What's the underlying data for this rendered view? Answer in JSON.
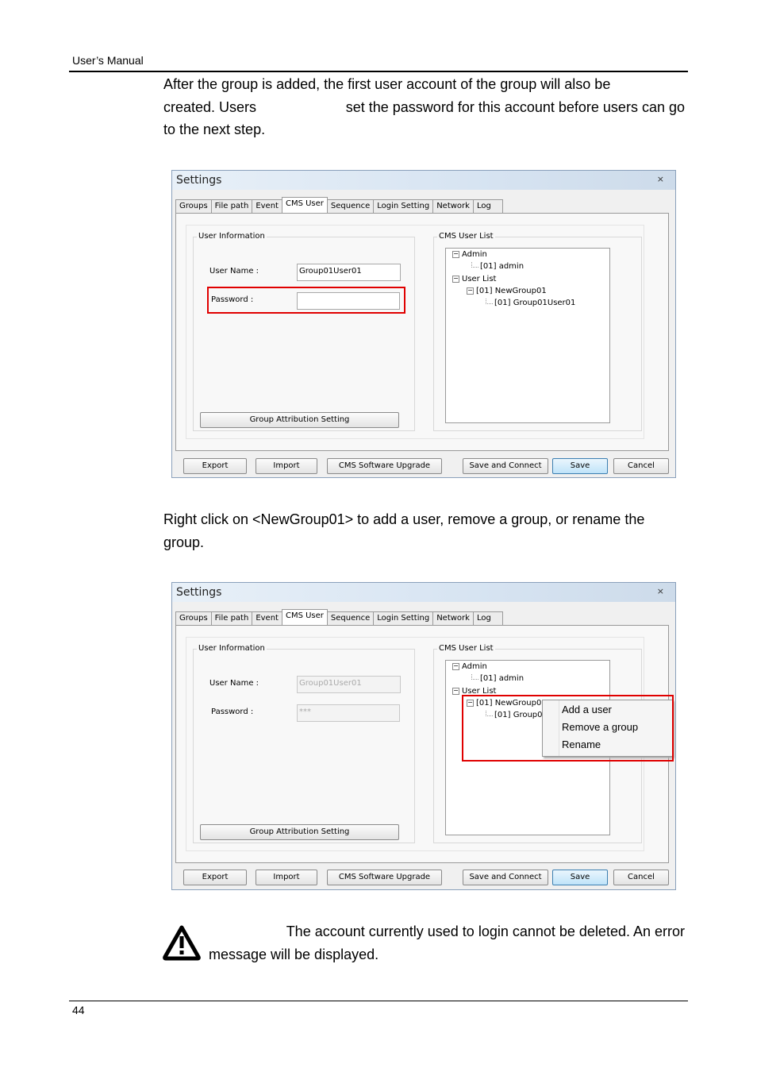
{
  "header": {
    "text": "User’s Manual"
  },
  "footer": {
    "page_number": "44"
  },
  "paragraph1": {
    "line1": "After the group is added, the first user account of the group will also be",
    "line2a": "created. Users",
    "line2b": "set the password for this account before users can go",
    "line3": "to the next step."
  },
  "paragraph2": {
    "line1": "Right click on <NewGroup01> to add a user, remove a group, or rename the",
    "line2": "group."
  },
  "note": {
    "line1": "The account currently used to login cannot be deleted. An error",
    "line2": "message will be displayed."
  },
  "dialog": {
    "title": "Settings",
    "close_glyph": "×",
    "tabs": [
      "Groups",
      "File path",
      "Event",
      "CMS User",
      "Sequence",
      "Login Setting",
      "Network",
      "Log"
    ],
    "user_info_label": "User Information",
    "user_list_label": "CMS User List",
    "user_name_label": "User Name :",
    "password_label": "Password :",
    "user_name_value": "Group01User01",
    "password_masked": "***",
    "group_attr_button": "Group Attribution Setting",
    "tree": {
      "admin": "Admin",
      "admin_child": "[01] admin",
      "user_list": "User List",
      "group": "[01] NewGroup01",
      "group_user": "[01] Group01User01",
      "group_user_truncated": "[01] Group01"
    },
    "buttons": {
      "export": "Export",
      "import": "Import",
      "upgrade": "CMS Software Upgrade",
      "save_connect": "Save and Connect",
      "save": "Save",
      "cancel": "Cancel"
    }
  },
  "context_menu": {
    "items": [
      "Add a user",
      "Remove a group",
      "Rename"
    ]
  },
  "colors": {
    "highlight_box": "#e00000",
    "default_button": "#3c7fb1"
  }
}
